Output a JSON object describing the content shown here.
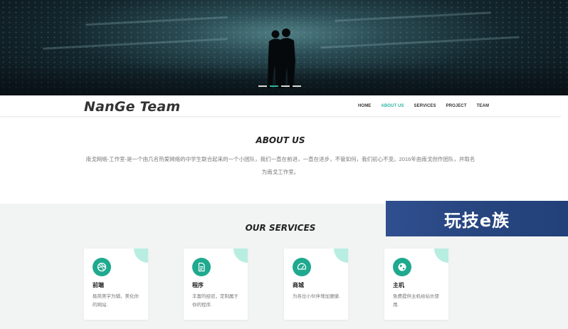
{
  "hero": {
    "carousel_count": 4,
    "carousel_active": 1
  },
  "nav": {
    "logo": "NanGe Team",
    "items": [
      {
        "label": "HOME",
        "active": false
      },
      {
        "label": "ABOUT US",
        "active": true
      },
      {
        "label": "SERVICES",
        "active": false
      },
      {
        "label": "PROJECT",
        "active": false
      },
      {
        "label": "TEAM",
        "active": false
      }
    ]
  },
  "about": {
    "title": "ABOUT US",
    "text": "南戈网络-工作室-是一个由几名热爱网络的中学生联合起来的一个小团队，我们一直在前进，一直在进步，不管如何，我们初心不变。2016年由南戈创作团队，并取名为南戈工作室。"
  },
  "services": {
    "title": "OUR SERVICES",
    "cards": [
      {
        "icon": "dribbble-icon",
        "name": "前端",
        "desc": "极简美学为辅，美化你的网站."
      },
      {
        "icon": "document-icon",
        "name": "程序",
        "desc": "丰富的经验，定制属于你的程序."
      },
      {
        "icon": "gauge-icon",
        "name": "商城",
        "desc": "为各位小伙伴增加便捷."
      },
      {
        "icon": "globe-icon",
        "name": "主机",
        "desc": "免费提供主机给站长使用."
      }
    ]
  },
  "watermark": {
    "text": "玩技e族"
  },
  "colors": {
    "accent": "#2bb3a0",
    "icon_bg": "#1fa98f",
    "corner": "#b8eee2",
    "services_bg": "#f2f3f3"
  }
}
